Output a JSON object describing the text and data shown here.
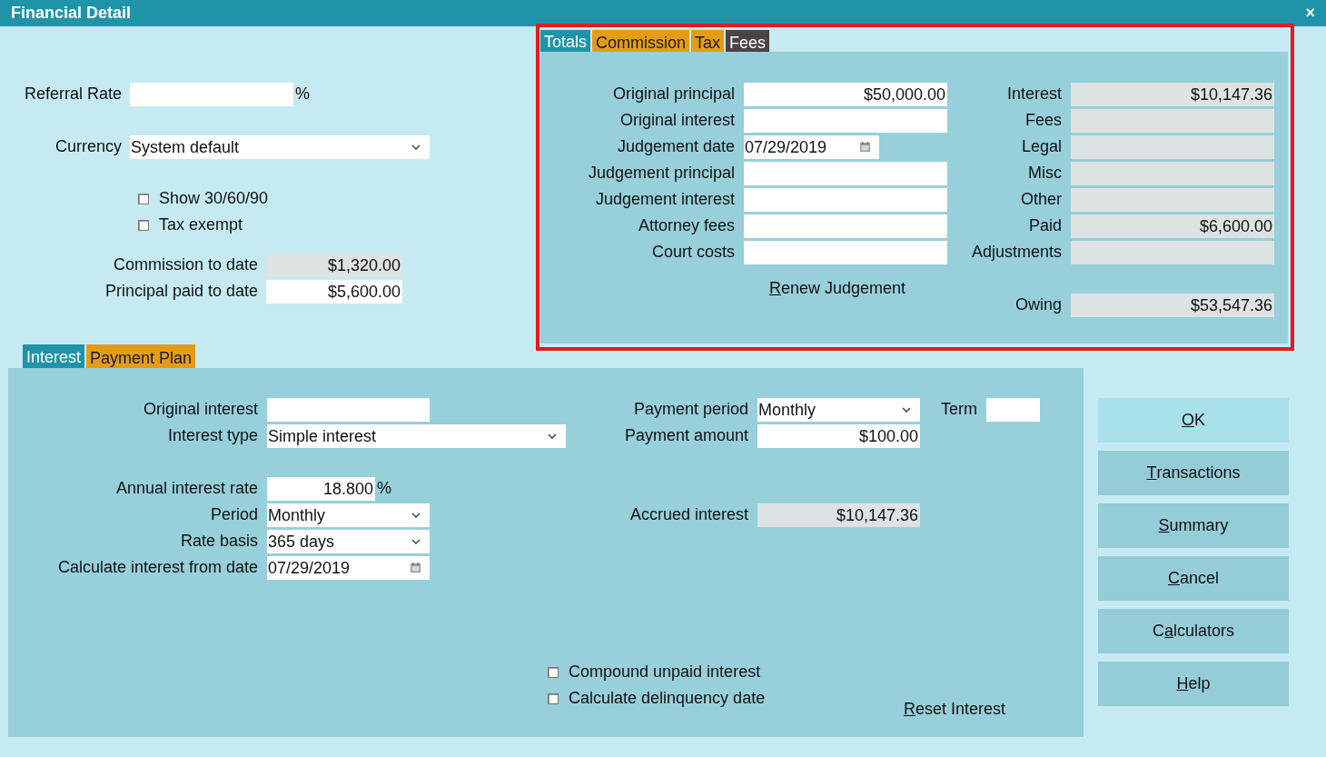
{
  "window": {
    "title": "Financial Detail",
    "close": "×"
  },
  "general": {
    "referral_rate": {
      "label": "Referral Rate",
      "kind": "text",
      "suffix": "%"
    },
    "currency": {
      "label": "Currency",
      "kind": "select",
      "value": "System default"
    },
    "checkboxes": [
      {
        "label": "Show 30/60/90",
        "checked": false
      },
      {
        "label": "Tax exempt",
        "checked": false
      }
    ],
    "totals": [
      {
        "label": "Commission to date",
        "kind": "readonly",
        "value": "$1,320.00"
      },
      {
        "label": "Principal paid to date",
        "kind": "money",
        "value": "$5,600.00"
      }
    ]
  },
  "summary_panel": {
    "highlighted": true,
    "tabs": [
      {
        "label": "Totals",
        "selected": true,
        "color": "#1f94a9"
      },
      {
        "label": "Commission",
        "selected": false,
        "color": "#e49c16"
      },
      {
        "label": "Tax",
        "selected": false,
        "color": "#e49c16"
      },
      {
        "label": "Fees",
        "selected": false,
        "color": "#4a4444"
      }
    ],
    "left_fields": [
      {
        "label": "Original principal",
        "kind": "money",
        "value": "$50,000.00"
      },
      {
        "label": "Original interest",
        "kind": "money"
      },
      {
        "label": "Judgement date",
        "kind": "date",
        "value": "07/29/2019"
      },
      {
        "label": "Judgement principal",
        "kind": "money"
      },
      {
        "label": "Judgement interest",
        "kind": "money"
      },
      {
        "label": "Attorney fees",
        "kind": "money"
      },
      {
        "label": "Court costs",
        "kind": "money"
      }
    ],
    "right_fields": [
      {
        "label": "Interest",
        "kind": "readonly",
        "value": "$10,147.36"
      },
      {
        "label": "Fees",
        "kind": "readonly"
      },
      {
        "label": "Legal",
        "kind": "readonly"
      },
      {
        "label": "Misc",
        "kind": "readonly"
      },
      {
        "label": "Other",
        "kind": "readonly"
      },
      {
        "label": "Paid",
        "kind": "readonly",
        "value": "$6,600.00"
      },
      {
        "label": "Adjustments",
        "kind": "readonly"
      }
    ],
    "renew_link": {
      "key": "R",
      "after": "enew Judgement"
    },
    "owing": {
      "label": "Owing",
      "kind": "readonly",
      "value": "$53,547.36"
    }
  },
  "interest_panel": {
    "tabs": [
      {
        "label": "Interest",
        "selected": true,
        "color": "#1f94a9"
      },
      {
        "label": "Payment Plan",
        "selected": false,
        "color": "#e49c16"
      }
    ],
    "left_fields": [
      {
        "label": "Original interest",
        "kind": "money"
      },
      {
        "label": "Interest type",
        "kind": "select",
        "value": "Simple interest"
      },
      {
        "label": "Annual interest rate",
        "kind": "money",
        "value": "18.800",
        "suffix": "%"
      },
      {
        "label": "Period",
        "kind": "select",
        "value": "Monthly"
      },
      {
        "label": "Rate basis",
        "kind": "select",
        "value": "365 days"
      },
      {
        "label": "Calculate interest from date",
        "kind": "date",
        "value": "07/29/2019"
      }
    ],
    "payment_period": {
      "label": "Payment period",
      "kind": "select",
      "value": "Monthly"
    },
    "term": {
      "label": "Term",
      "kind": "text"
    },
    "payment_amount": {
      "label": "Payment amount",
      "kind": "money",
      "value": "$100.00"
    },
    "accrued_interest": {
      "label": "Accrued interest",
      "kind": "readonly",
      "value": "$10,147.36"
    },
    "checkboxes": [
      {
        "label": "Compound unpaid interest",
        "checked": false
      },
      {
        "label": "Calculate delinquency date",
        "checked": false
      }
    ],
    "reset_link": {
      "key": "R",
      "after": "eset Interest"
    }
  },
  "buttons": [
    {
      "key": "O",
      "after": "K",
      "focused": true
    },
    {
      "key": "T",
      "after": "ransactions",
      "focused": false
    },
    {
      "key": "S",
      "after": "ummary",
      "focused": false
    },
    {
      "key": "C",
      "after": "ancel",
      "focused": false
    },
    {
      "before": "C",
      "key": "a",
      "after": "lculators",
      "focused": false
    },
    {
      "key": "H",
      "after": "elp",
      "focused": false
    }
  ]
}
